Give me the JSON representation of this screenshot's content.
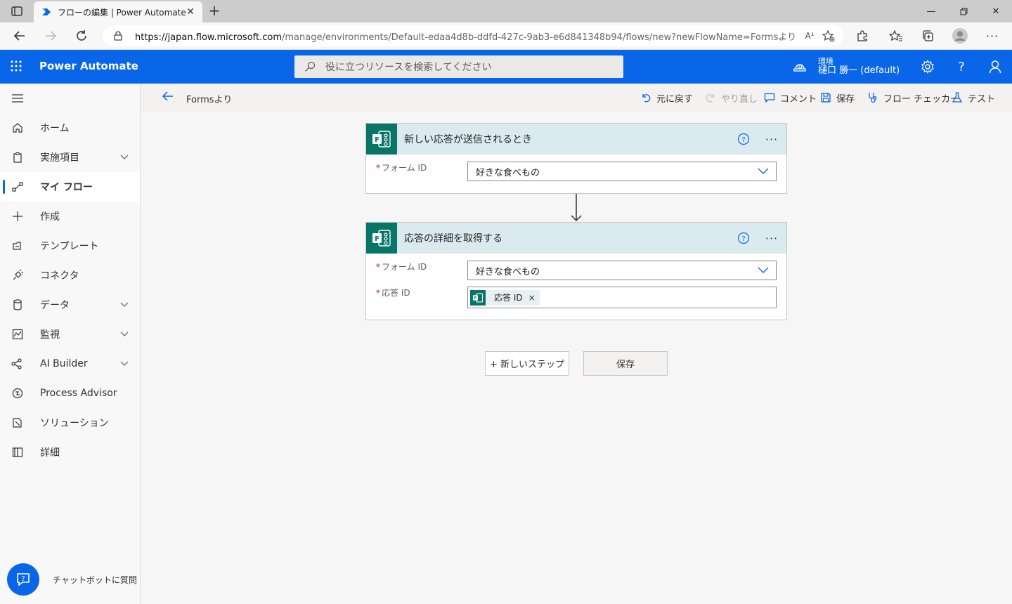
{
  "browser": {
    "tab_title": "フローの編集 | Power Automate",
    "url_host": "https://japan.flow.microsoft.com",
    "url_path": "/manage/environments/Default-edaa4d8b-ddfd-427c-9ab3-e6d841348b94/flows/new?newFlowName=Formsより&tr...",
    "read_aloud": "A¹"
  },
  "header": {
    "app_name": "Power Automate",
    "search_placeholder": "役に立つリソースを検索してください",
    "env_label": "環境",
    "env_name": "樋口 勝一 (default)",
    "help": "?"
  },
  "sidebar": {
    "items": [
      {
        "label": "ホーム"
      },
      {
        "label": "実施項目"
      },
      {
        "label": "マイ フロー"
      },
      {
        "label": "作成"
      },
      {
        "label": "テンプレート"
      },
      {
        "label": "コネクタ"
      },
      {
        "label": "データ"
      },
      {
        "label": "監視"
      },
      {
        "label": "AI Builder"
      },
      {
        "label": "Process Advisor"
      },
      {
        "label": "ソリューション"
      },
      {
        "label": "詳細"
      }
    ],
    "chatbot_label": "チャットボットに質問"
  },
  "commandbar": {
    "flow_name": "Formsより",
    "undo": "元に戻す",
    "redo": "やり直し",
    "comment": "コメント",
    "save": "保存",
    "checker": "フロー チェッカー",
    "test": "テスト"
  },
  "flow": {
    "trigger": {
      "title": "新しい応答が送信されるとき",
      "form_label": "フォーム ID",
      "form_value": "好きな食べもの"
    },
    "action": {
      "title": "応答の詳細を取得する",
      "form_label": "フォーム ID",
      "form_value": "好きな食べもの",
      "response_label": "応答 ID",
      "response_token": "応答 ID",
      "token_close": "×"
    },
    "required_mark": "*",
    "new_step": "+ 新しいステップ",
    "save": "保存"
  },
  "colors": {
    "brand": "#0a66e8",
    "forms_green": "#077568",
    "card_header": "#daeaee"
  }
}
